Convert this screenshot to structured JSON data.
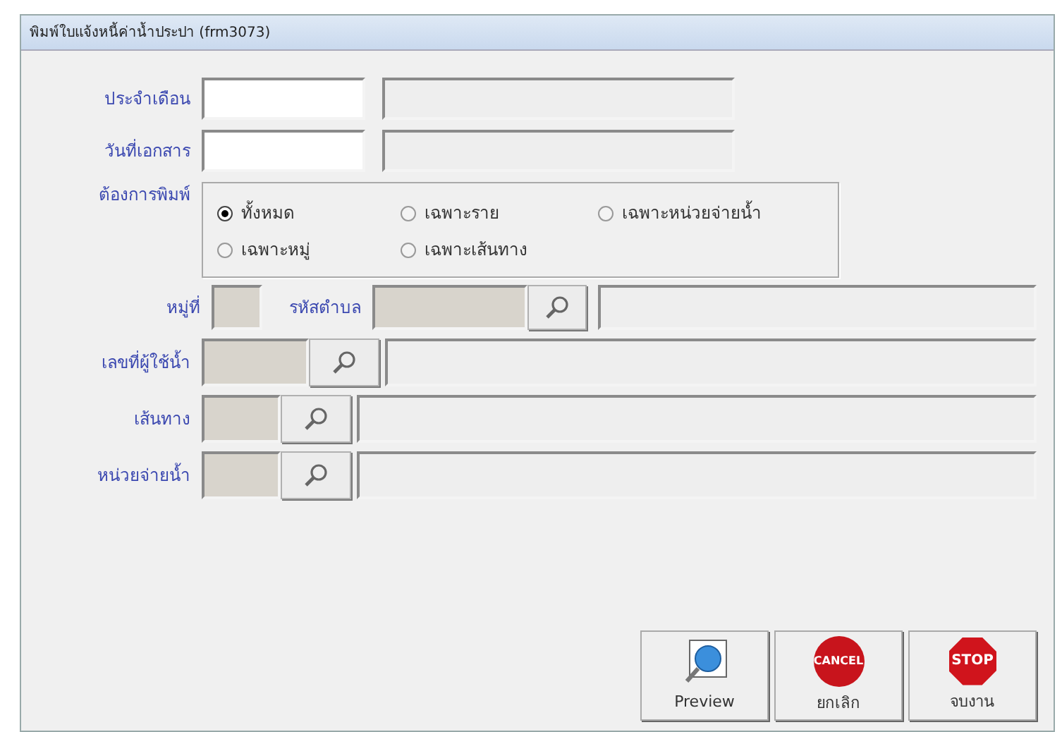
{
  "window": {
    "title": "พิมพ์ใบแจ้งหนี้ค่าน้ำประปา (frm3073)"
  },
  "month": {
    "label": "ประจำเดือน"
  },
  "doc_date": {
    "label": "วันที่เอกสาร"
  },
  "print_option": {
    "label": "ต้องการพิมพ์",
    "options": [
      {
        "label": "ทั้งหมด",
        "selected": true
      },
      {
        "label": "เฉพาะราย",
        "selected": false
      },
      {
        "label": "เฉพาะหน่วยจ่ายน้ำ",
        "selected": false
      },
      {
        "label": "เฉพาะหมู่",
        "selected": false
      },
      {
        "label": "เฉพาะเส้นทาง",
        "selected": false
      }
    ]
  },
  "village": {
    "label": "หมู่ที่",
    "subdistrict_label": "รหัสตำบล"
  },
  "lookups": [
    {
      "label": "เลขที่ผู้ใช้น้ำ"
    },
    {
      "label": "เส้นทาง"
    },
    {
      "label": "หน่วยจ่ายน้ำ"
    }
  ],
  "buttons": [
    {
      "kind": "preview",
      "label": "Preview"
    },
    {
      "kind": "cancel",
      "label": "ยกเลิก",
      "icon_text": "CANCEL"
    },
    {
      "kind": "stop",
      "label": "จบงาน",
      "icon_text": "STOP"
    }
  ]
}
